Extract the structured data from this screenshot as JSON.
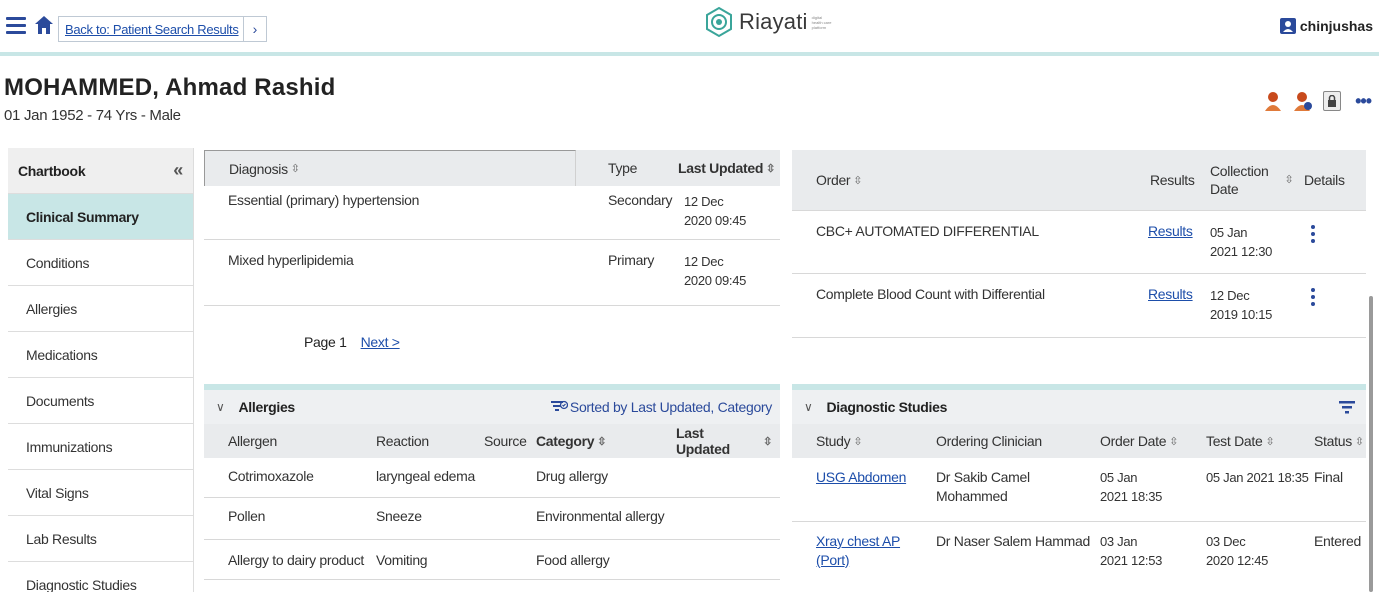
{
  "topbar": {
    "back_label": "Back to: Patient Search Results",
    "chevron": "›",
    "brand_name": "Riayati",
    "brand_tagline": "digital health care platform",
    "username": "chinjushas",
    "icons": [
      "hamburger-icon",
      "home-icon",
      "chevron-right-icon",
      "riayati-logo-icon",
      "user-icon"
    ]
  },
  "patient": {
    "name": "MOHAMMED, Ahmad Rashid",
    "info": "01 Jan 1952 - 74 Yrs - Male",
    "more": "•••"
  },
  "sidebar": {
    "title": "Chartbook",
    "collapse": "«",
    "items": [
      {
        "label": "Clinical Summary"
      },
      {
        "label": "Conditions"
      },
      {
        "label": "Allergies"
      },
      {
        "label": "Medications"
      },
      {
        "label": "Documents"
      },
      {
        "label": "Immunizations"
      },
      {
        "label": "Vital Signs"
      },
      {
        "label": "Lab Results"
      },
      {
        "label": "Diagnostic Studies"
      }
    ]
  },
  "conditions": {
    "headers": {
      "diagnosis": "Diagnosis",
      "type": "Type",
      "last_updated": "Last Updated"
    },
    "rows": [
      {
        "diagnosis": "Essential (primary) hypertension",
        "type": "Secondary",
        "date1": "12 Dec",
        "date2": "2020 09:45"
      },
      {
        "diagnosis": "Mixed hyperlipidemia",
        "type": "Primary",
        "date1": "12 Dec",
        "date2": "2020 09:45"
      }
    ],
    "page_label": "Page 1",
    "next_label": "Next >"
  },
  "labs": {
    "headers": {
      "order": "Order",
      "results": "Results",
      "collection1": "Collection",
      "collection2": "Date",
      "details": "Details"
    },
    "rows": [
      {
        "order": "CBC+ AUTOMATED DIFFERENTIAL",
        "results": "Results",
        "date1": "05 Jan",
        "date2": "2021 12:30"
      },
      {
        "order": "Complete Blood Count with Differential",
        "results": "Results",
        "date1": "12 Dec",
        "date2": "2019 10:15"
      }
    ]
  },
  "allergies": {
    "title": "Allergies",
    "sorted_label": "Sorted by Last Updated, Category",
    "headers": {
      "allergen": "Allergen",
      "reaction": "Reaction",
      "source": "Source",
      "category": "Category",
      "last_updated": "Last Updated"
    },
    "rows": [
      {
        "allergen": "Cotrimoxazole",
        "reaction": "laryngeal edema",
        "source": "",
        "category": "Drug allergy"
      },
      {
        "allergen": "Pollen",
        "reaction": "Sneeze",
        "source": "",
        "category": "Environmental allergy"
      },
      {
        "allergen": "Allergy to dairy product",
        "reaction": "Vomiting",
        "source": "",
        "category": "Food allergy"
      }
    ]
  },
  "studies": {
    "title": "Diagnostic Studies",
    "headers": {
      "study": "Study",
      "clinician": "Ordering Clinician",
      "order_date": "Order Date",
      "test_date": "Test Date",
      "status": "Status"
    },
    "rows": [
      {
        "study1": "USG Abdomen",
        "study2": "",
        "clin1": "Dr Sakib Camel",
        "clin2": "Mohammed",
        "od1": "05 Jan",
        "od2": "2021 18:35",
        "td1": "05 Jan 2021 18:35",
        "td2": "",
        "status": "Final"
      },
      {
        "study1": "Xray chest AP",
        "study2": "(Port)",
        "clin1": "Dr Naser Salem Hammad",
        "clin2": "",
        "od1": "03 Jan",
        "od2": "2021 12:53",
        "td1": "03 Dec",
        "td2": "2020 12:45",
        "status": "Entered"
      }
    ]
  },
  "colors": {
    "accent": "#2b4a9b",
    "teal": "#c8e6e6",
    "link": "#1d4eaa"
  }
}
